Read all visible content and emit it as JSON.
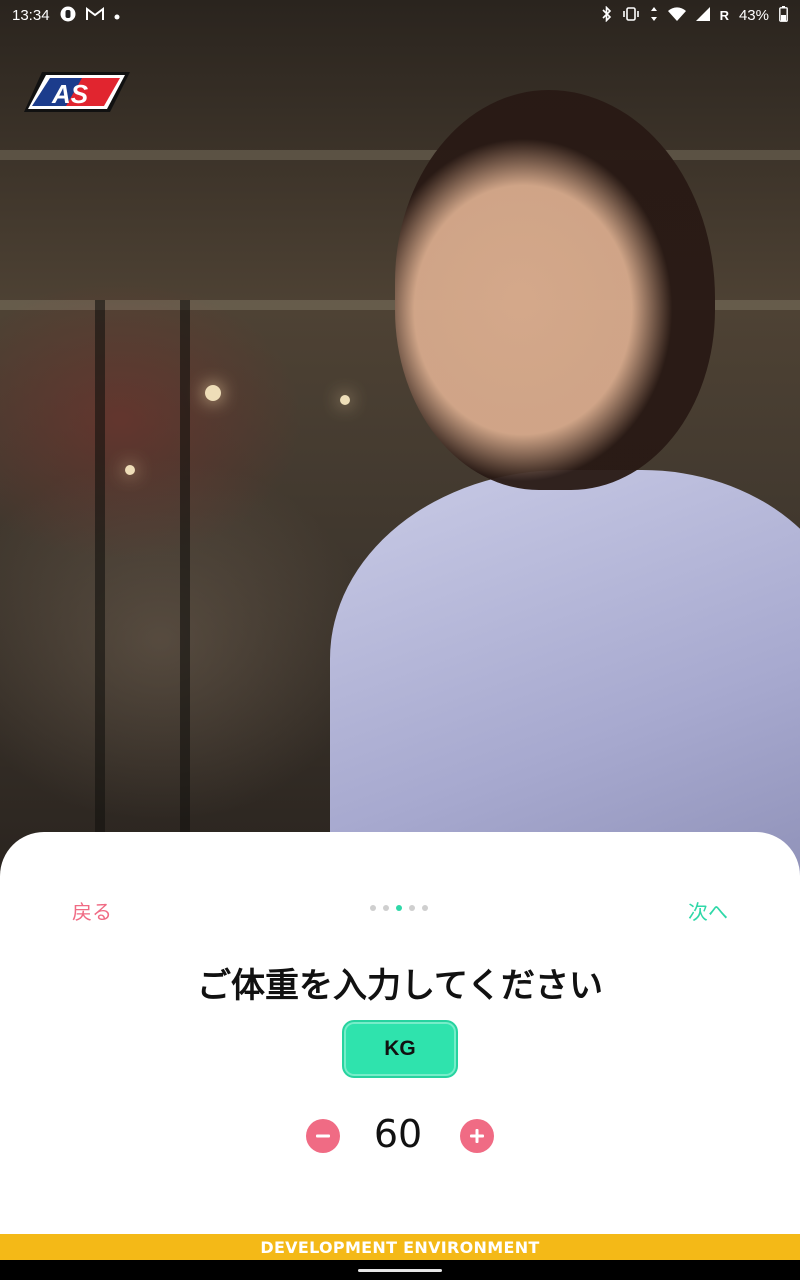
{
  "status_bar": {
    "time": "13:34",
    "battery": "43%",
    "left_icons": [
      "shield-icon",
      "gmail-icon",
      "notification-dot-icon"
    ],
    "right_icons": [
      "bluetooth-icon",
      "vibrate-icon",
      "data-arrows-icon",
      "wifi-icon",
      "signal-icon",
      "roaming-r-icon",
      "battery-icon"
    ],
    "roaming": "R"
  },
  "logo": {
    "text": "AS",
    "colors": {
      "red": "#e1252f",
      "blue": "#1c3c8c",
      "white": "#ffffff"
    }
  },
  "sheet": {
    "back_label": "戻る",
    "next_label": "次へ",
    "page_indicator": {
      "total": 5,
      "active": 3
    },
    "question": "ご体重を入力してください",
    "unit_label": "KG",
    "weight_value": "60",
    "decrease_icon": "minus-icon",
    "increase_icon": "plus-icon"
  },
  "dev_banner": "DEVELOPMENT ENVIRONMENT",
  "colors": {
    "accent_green": "#2fe3ad",
    "accent_pink": "#f06b84",
    "banner_yellow": "#f4b917"
  }
}
